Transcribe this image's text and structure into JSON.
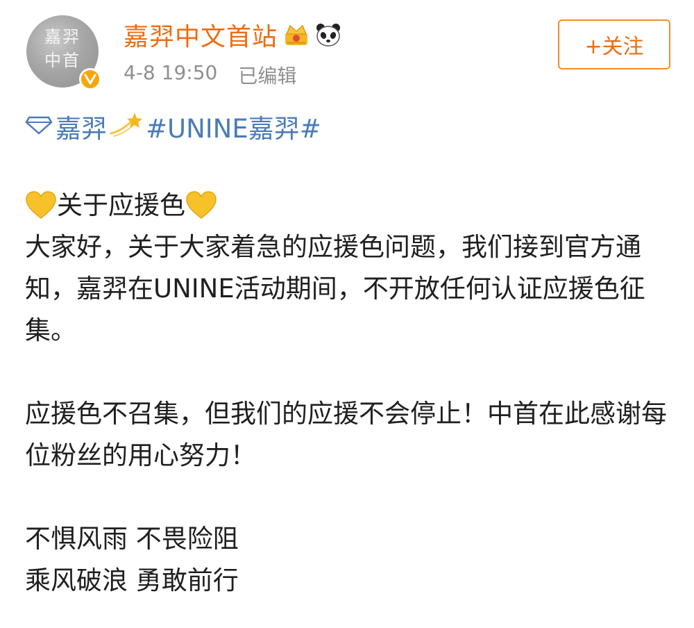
{
  "post": {
    "author": {
      "name": "嘉羿中文首站",
      "avatar_text": "嘉羿\n中首",
      "verified": true,
      "badges": [
        "crown-icon",
        "panda-icon"
      ]
    },
    "meta": {
      "timestamp": "4-8 19:50",
      "edited_label": "已编辑"
    },
    "follow_label": "+关注",
    "topic": {
      "prefix": "嘉羿",
      "hashtag": "#UNINE嘉羿#"
    },
    "body": {
      "heading": "关于应援色",
      "p1": "大家好，关于大家着急的应援色问题，我们接到官方通知，嘉羿在UNINE活动期间，不开放任何认证应援色征集。",
      "p2": "应援色不召集，但我们的应援不会停止！中首在此感谢每位粉丝的用心努力！",
      "p3_line1": "不惧风雨 不畏险阻",
      "p3_line2": "乘风破浪 勇敢前行"
    }
  },
  "colors": {
    "username": "#ee6c10",
    "link": "#4a7bb7",
    "meta": "#8f8f8f",
    "follow_border": "#f28b2e"
  }
}
